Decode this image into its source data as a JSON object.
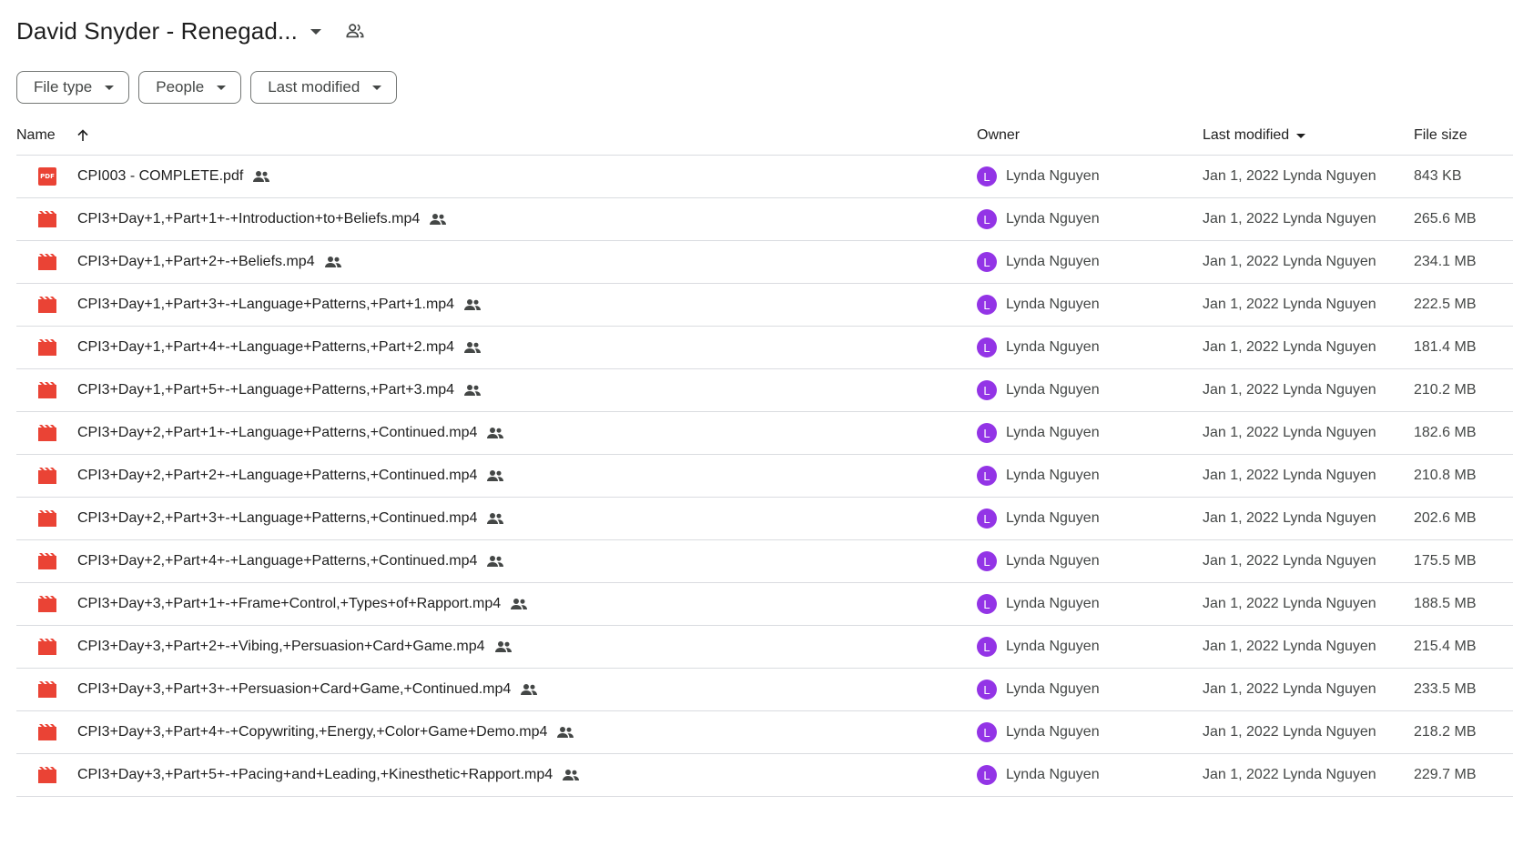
{
  "folder": {
    "title": "David Snyder - Renegad...",
    "shared_icon": "shared-folder-icon"
  },
  "filters": [
    {
      "label": "File type"
    },
    {
      "label": "People"
    },
    {
      "label": "Last modified"
    }
  ],
  "columns": {
    "name": "Name",
    "owner": "Owner",
    "last_modified": "Last modified",
    "file_size": "File size"
  },
  "colors": {
    "avatar": "#9334e6",
    "file_icon": "#ea4335",
    "border": "#dadce0"
  },
  "files": [
    {
      "type": "pdf",
      "icon": "pdf-icon",
      "name": "CPI003 - COMPLETE.pdf",
      "owner_initial": "L",
      "owner": "Lynda Nguyen",
      "modified": "Jan 1, 2022 Lynda Nguyen",
      "size": "843 KB"
    },
    {
      "type": "video",
      "icon": "video-icon",
      "name": "CPI3+Day+1,+Part+1+-+Introduction+to+Beliefs.mp4",
      "owner_initial": "L",
      "owner": "Lynda Nguyen",
      "modified": "Jan 1, 2022 Lynda Nguyen",
      "size": "265.6 MB"
    },
    {
      "type": "video",
      "icon": "video-icon",
      "name": "CPI3+Day+1,+Part+2+-+Beliefs.mp4",
      "owner_initial": "L",
      "owner": "Lynda Nguyen",
      "modified": "Jan 1, 2022 Lynda Nguyen",
      "size": "234.1 MB"
    },
    {
      "type": "video",
      "icon": "video-icon",
      "name": "CPI3+Day+1,+Part+3+-+Language+Patterns,+Part+1.mp4",
      "owner_initial": "L",
      "owner": "Lynda Nguyen",
      "modified": "Jan 1, 2022 Lynda Nguyen",
      "size": "222.5 MB"
    },
    {
      "type": "video",
      "icon": "video-icon",
      "name": "CPI3+Day+1,+Part+4+-+Language+Patterns,+Part+2.mp4",
      "owner_initial": "L",
      "owner": "Lynda Nguyen",
      "modified": "Jan 1, 2022 Lynda Nguyen",
      "size": "181.4 MB"
    },
    {
      "type": "video",
      "icon": "video-icon",
      "name": "CPI3+Day+1,+Part+5+-+Language+Patterns,+Part+3.mp4",
      "owner_initial": "L",
      "owner": "Lynda Nguyen",
      "modified": "Jan 1, 2022 Lynda Nguyen",
      "size": "210.2 MB"
    },
    {
      "type": "video",
      "icon": "video-icon",
      "name": "CPI3+Day+2,+Part+1+-+Language+Patterns,+Continued.mp4",
      "owner_initial": "L",
      "owner": "Lynda Nguyen",
      "modified": "Jan 1, 2022 Lynda Nguyen",
      "size": "182.6 MB"
    },
    {
      "type": "video",
      "icon": "video-icon",
      "name": "CPI3+Day+2,+Part+2+-+Language+Patterns,+Continued.mp4",
      "owner_initial": "L",
      "owner": "Lynda Nguyen",
      "modified": "Jan 1, 2022 Lynda Nguyen",
      "size": "210.8 MB"
    },
    {
      "type": "video",
      "icon": "video-icon",
      "name": "CPI3+Day+2,+Part+3+-+Language+Patterns,+Continued.mp4",
      "owner_initial": "L",
      "owner": "Lynda Nguyen",
      "modified": "Jan 1, 2022 Lynda Nguyen",
      "size": "202.6 MB"
    },
    {
      "type": "video",
      "icon": "video-icon",
      "name": "CPI3+Day+2,+Part+4+-+Language+Patterns,+Continued.mp4",
      "owner_initial": "L",
      "owner": "Lynda Nguyen",
      "modified": "Jan 1, 2022 Lynda Nguyen",
      "size": "175.5 MB"
    },
    {
      "type": "video",
      "icon": "video-icon",
      "name": "CPI3+Day+3,+Part+1+-+Frame+Control,+Types+of+Rapport.mp4",
      "owner_initial": "L",
      "owner": "Lynda Nguyen",
      "modified": "Jan 1, 2022 Lynda Nguyen",
      "size": "188.5 MB"
    },
    {
      "type": "video",
      "icon": "video-icon",
      "name": "CPI3+Day+3,+Part+2+-+Vibing,+Persuasion+Card+Game.mp4",
      "owner_initial": "L",
      "owner": "Lynda Nguyen",
      "modified": "Jan 1, 2022 Lynda Nguyen",
      "size": "215.4 MB"
    },
    {
      "type": "video",
      "icon": "video-icon",
      "name": "CPI3+Day+3,+Part+3+-+Persuasion+Card+Game,+Continued.mp4",
      "owner_initial": "L",
      "owner": "Lynda Nguyen",
      "modified": "Jan 1, 2022 Lynda Nguyen",
      "size": "233.5 MB"
    },
    {
      "type": "video",
      "icon": "video-icon",
      "name": "CPI3+Day+3,+Part+4+-+Copywriting,+Energy,+Color+Game+Demo.mp4",
      "owner_initial": "L",
      "owner": "Lynda Nguyen",
      "modified": "Jan 1, 2022 Lynda Nguyen",
      "size": "218.2 MB"
    },
    {
      "type": "video",
      "icon": "video-icon",
      "name": "CPI3+Day+3,+Part+5+-+Pacing+and+Leading,+Kinesthetic+Rapport.mp4",
      "owner_initial": "L",
      "owner": "Lynda Nguyen",
      "modified": "Jan 1, 2022 Lynda Nguyen",
      "size": "229.7 MB"
    }
  ]
}
